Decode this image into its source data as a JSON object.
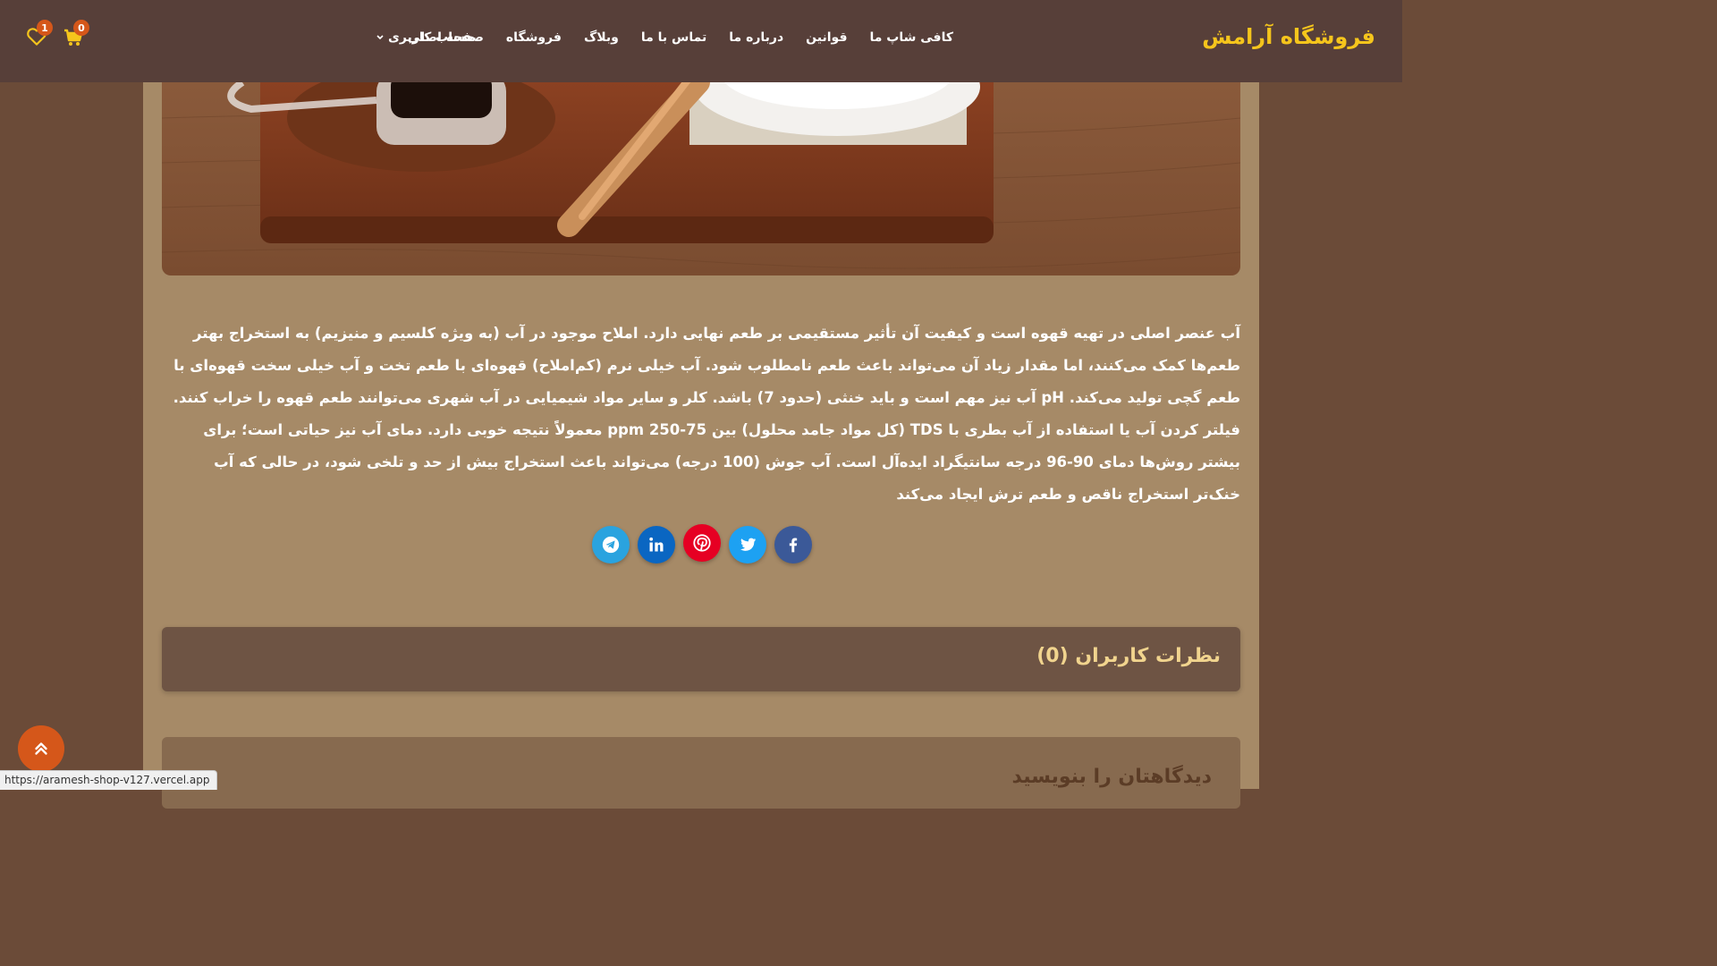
{
  "header": {
    "logo": "فروشگاه آرامش",
    "nav": [
      {
        "label": "صفحه اصلی"
      },
      {
        "label": "فروشگاه"
      },
      {
        "label": "وبلاگ"
      },
      {
        "label": "تماس با ما"
      },
      {
        "label": "درباره ما"
      },
      {
        "label": "قوانین"
      },
      {
        "label": "کافی شاپ ما"
      }
    ],
    "account_label": "حساب کاربری",
    "cart_count": "0",
    "wishlist_count": "1"
  },
  "article": {
    "paragraph": "آب عنصر اصلی در تهیه قهوه است و کیفیت آن تأثیر مستقیمی بر طعم نهایی دارد. املاح موجود در آب (به ویژه کلسیم و منیزیم) به استخراج بهتر طعم‌ها کمک می‌کنند، اما مقدار زیاد آن می‌تواند باعث طعم نامطلوب شود. آب خیلی نرم (کم‌املاح) قهوه‌ای با طعم تخت و آب خیلی سخت قهوه‌ای با طعم گچی تولید می‌کند. pH آب نیز مهم است و باید خنثی (حدود 7) باشد. کلر و سایر مواد شیمیایی در آب شهری می‌توانند طعم قهوه را خراب کنند. فیلتر کردن آب یا استفاده از آب بطری با TDS (کل مواد جامد محلول) بین 75-250 ppm معمولاً نتیجه خوبی دارد. دمای آب نیز حیاتی است؛ برای بیشتر روش‌ها دمای 90-96 درجه سانتیگراد ایده‌آل است. آب جوش (100 درجه) می‌تواند باعث استخراج بیش از حد و تلخی شود، در حالی که آب خنک‌تر استخراج ناقص و طعم ترش ایجاد می‌کند"
  },
  "share": [
    {
      "name": "facebook-icon",
      "color": "#3b5998"
    },
    {
      "name": "twitter-icon",
      "color": "#1da1f2"
    },
    {
      "name": "pinterest-icon",
      "color": "#e60023"
    },
    {
      "name": "linkedin-icon",
      "color": "#0a66c2"
    },
    {
      "name": "telegram-icon",
      "color": "#2aa3df"
    }
  ],
  "comments": {
    "title": "نظرات کاربران (0)"
  },
  "write_comment": {
    "title": "دیدگاهتان را بنویسید"
  },
  "status_url": "https://aramesh-shop-v127.vercel.app",
  "colors": {
    "header_bg": "#573f39",
    "logo": "#f5c51c",
    "page_bg": "#6b4b38",
    "content_bg": "#a68a67",
    "accent": "#d5571a"
  }
}
